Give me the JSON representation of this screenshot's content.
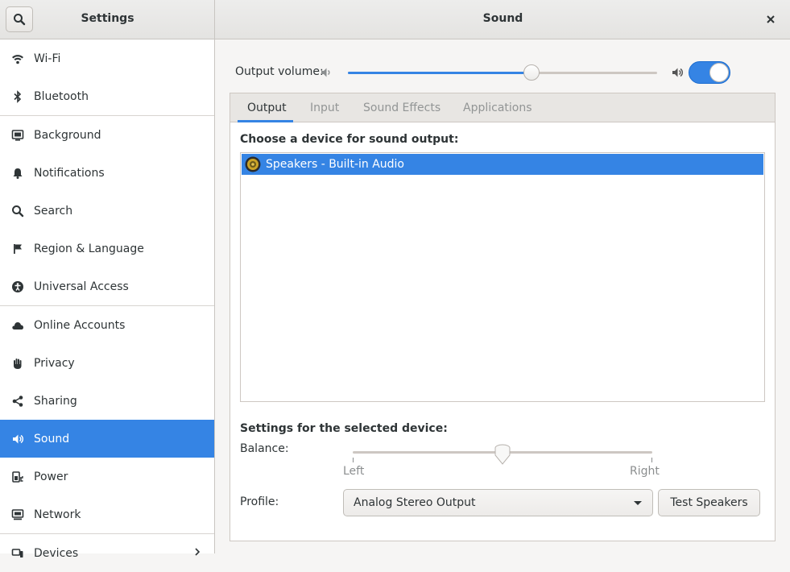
{
  "window": {
    "settings_title": "Settings",
    "panel_title": "Sound"
  },
  "sidebar": {
    "items": [
      {
        "label": "Wi-Fi",
        "icon": "wifi-icon"
      },
      {
        "label": "Bluetooth",
        "icon": "bluetooth-icon"
      },
      {
        "label": "Background",
        "icon": "background-icon"
      },
      {
        "label": "Notifications",
        "icon": "bell-icon"
      },
      {
        "label": "Search",
        "icon": "search-icon"
      },
      {
        "label": "Region & Language",
        "icon": "flag-icon"
      },
      {
        "label": "Universal Access",
        "icon": "accessibility-icon"
      },
      {
        "label": "Online Accounts",
        "icon": "cloud-icon"
      },
      {
        "label": "Privacy",
        "icon": "hand-icon"
      },
      {
        "label": "Sharing",
        "icon": "share-icon"
      },
      {
        "label": "Sound",
        "icon": "speaker-icon",
        "active": true
      },
      {
        "label": "Power",
        "icon": "power-icon"
      },
      {
        "label": "Network",
        "icon": "network-icon"
      },
      {
        "label": "Devices",
        "icon": "devices-icon"
      }
    ]
  },
  "sound": {
    "output_volume_label": "Output volume:",
    "output_volume_level": 0.6,
    "volume_enabled": true,
    "tabs": [
      {
        "label": "Output",
        "active": true
      },
      {
        "label": "Input"
      },
      {
        "label": "Sound Effects"
      },
      {
        "label": "Applications"
      }
    ],
    "device_heading": "Choose a device for sound output:",
    "devices": [
      {
        "label": "Speakers - Built-in Audio",
        "selected": true
      }
    ],
    "settings_heading": "Settings for the selected device:",
    "balance_label": "Balance:",
    "balance_level": 0.5,
    "balance_left": "Left",
    "balance_right": "Right",
    "profile_label": "Profile:",
    "profile_value": "Analog Stereo Output",
    "test_button": "Test Speakers"
  },
  "colors": {
    "accent": "#3584e4"
  }
}
